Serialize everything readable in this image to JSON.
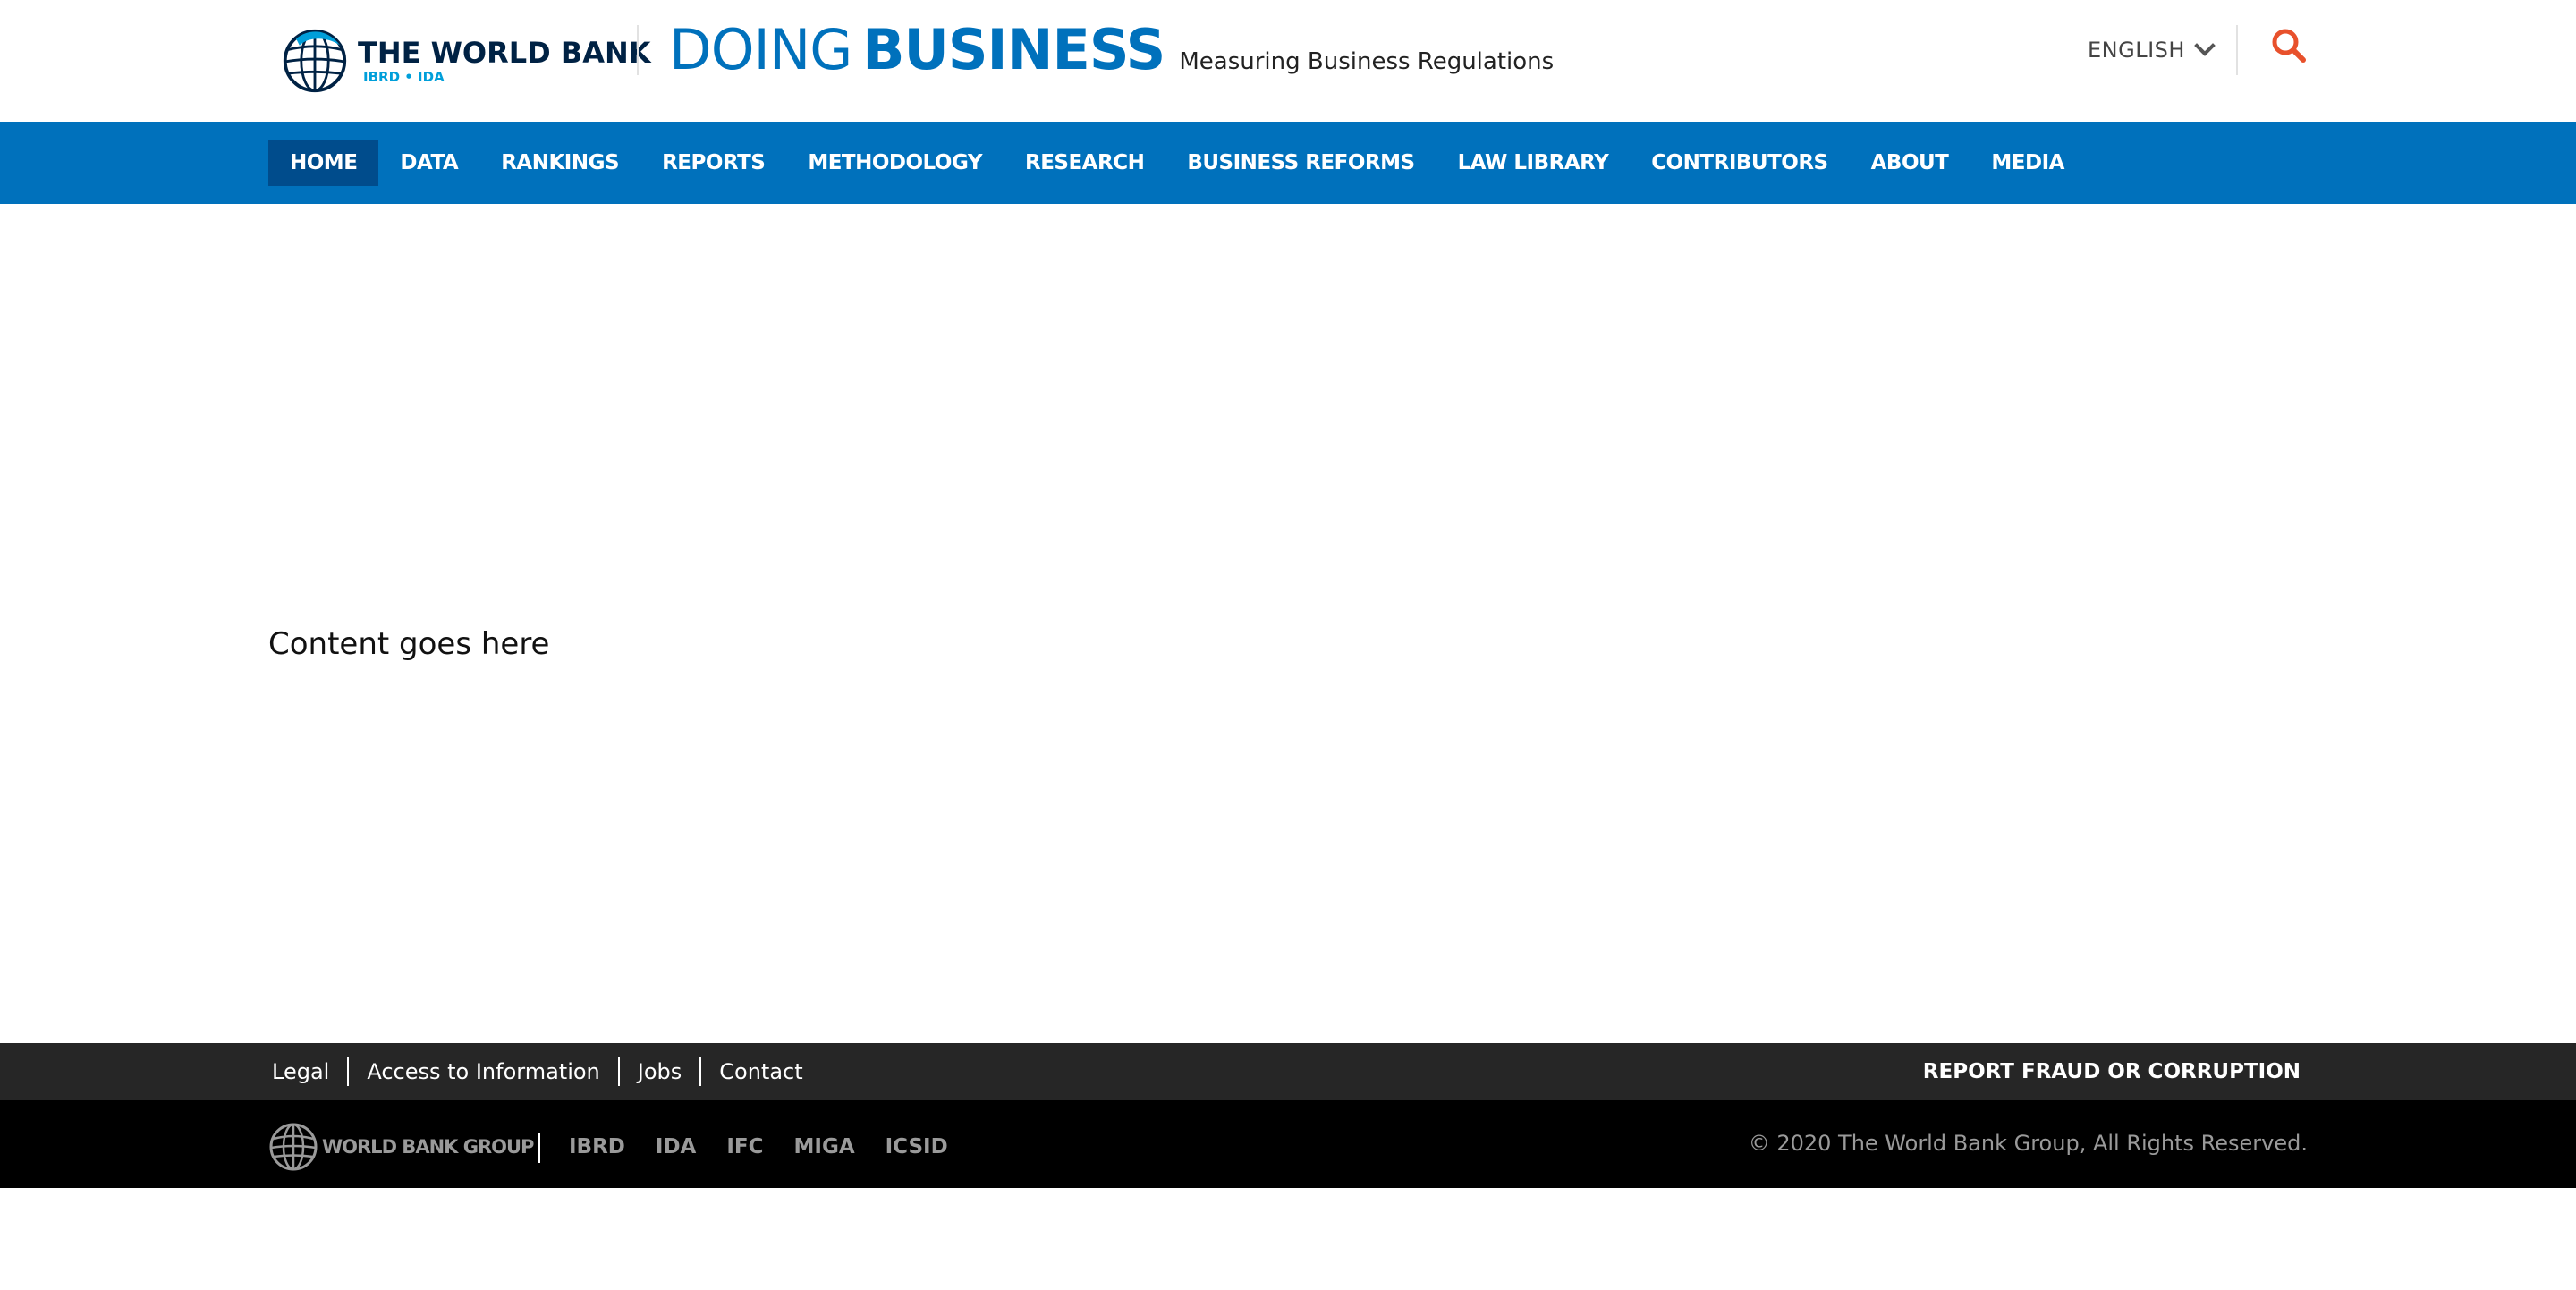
{
  "header": {
    "wb_name": "THE WORLD BANK",
    "wb_sub": "IBRD • IDA",
    "title_doing": "DOING",
    "title_business": "BUSINESS",
    "tagline": "Measuring Business Regulations",
    "language": "ENGLISH",
    "icons": {
      "logo": "globe-icon",
      "language": "chevron-down-icon",
      "search": "search-icon"
    },
    "colors": {
      "brand_blue": "#0071bc",
      "navy": "#002244",
      "light_blue": "#009fda",
      "search_red": "#e8512c"
    }
  },
  "nav": {
    "active_color": "#004c8c",
    "items": [
      {
        "label": "HOME",
        "active": true
      },
      {
        "label": "DATA"
      },
      {
        "label": "RANKINGS"
      },
      {
        "label": "REPORTS"
      },
      {
        "label": "METHODOLOGY"
      },
      {
        "label": "RESEARCH"
      },
      {
        "label": "BUSINESS REFORMS"
      },
      {
        "label": "LAW LIBRARY"
      },
      {
        "label": "CONTRIBUTORS"
      },
      {
        "label": "ABOUT"
      },
      {
        "label": "MEDIA"
      }
    ]
  },
  "main": {
    "content_text": "Content goes here"
  },
  "footer": {
    "links": [
      {
        "label": "Legal"
      },
      {
        "label": "Access to Information"
      },
      {
        "label": "Jobs"
      },
      {
        "label": "Contact"
      }
    ],
    "report_fraud": "REPORT FRAUD OR CORRUPTION",
    "wbg_name": "WORLD BANK GROUP",
    "orgs": [
      {
        "label": "IBRD"
      },
      {
        "label": "IDA"
      },
      {
        "label": "IFC"
      },
      {
        "label": "MIGA"
      },
      {
        "label": "ICSID"
      }
    ],
    "copyright": "© 2020 The World Bank Group, All Rights Reserved."
  }
}
